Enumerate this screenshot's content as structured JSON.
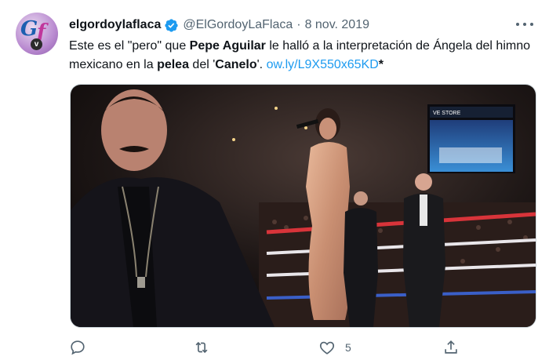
{
  "tweet": {
    "display_name": "elgordoylaflaca",
    "handle": "@ElGordoyLaFlaca",
    "separator": "·",
    "date": "8 nov. 2019",
    "text": {
      "part1": "Este es el \"pero\" que ",
      "bold1": "Pepe Aguilar",
      "part2": " le halló a la interpretación de Ángela del himno mexicano en la ",
      "bold2": "pelea",
      "part3": " del '",
      "bold3": "Canelo",
      "part4": "'.  ",
      "link": "ow.ly/L9X550x65KD",
      "trail": "*"
    },
    "avatar": {
      "letters_left": "G",
      "letters_right": "f",
      "badge": "v"
    },
    "media": {
      "scoreboard_text": "VE STORE"
    },
    "actions": {
      "reply_count": "",
      "retweet_count": "",
      "like_count": "5",
      "share_count": ""
    }
  },
  "colors": {
    "accent": "#1d9bf0",
    "secondary_text": "#536471",
    "verified": "#1d9bf0"
  },
  "icons": [
    "reply-icon",
    "retweet-icon",
    "heart-icon",
    "share-icon",
    "verified-badge-icon",
    "more-icon"
  ]
}
